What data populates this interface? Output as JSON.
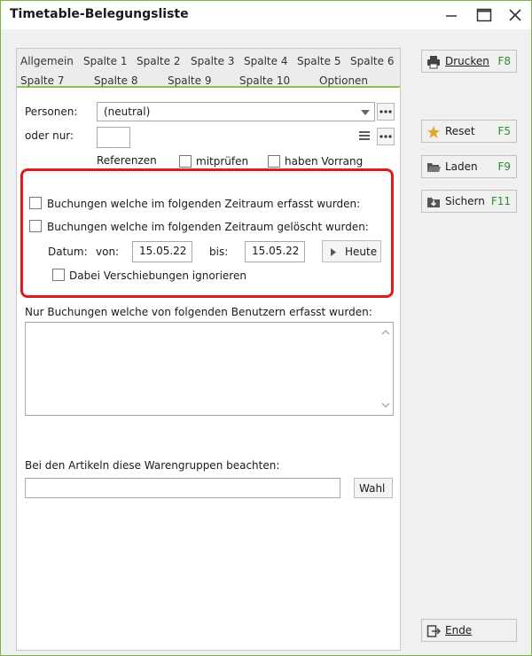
{
  "window": {
    "title": "Timetable-Belegungsliste"
  },
  "tabs": [
    {
      "label": "Allgemein"
    },
    {
      "label": "Spalte 1"
    },
    {
      "label": "Spalte 2"
    },
    {
      "label": "Spalte 3"
    },
    {
      "label": "Spalte 4"
    },
    {
      "label": "Spalte 5"
    },
    {
      "label": "Spalte 6"
    },
    {
      "label": "Spalte 7"
    },
    {
      "label": "Spalte 8"
    },
    {
      "label": "Spalte 9"
    },
    {
      "label": "Spalte 10"
    },
    {
      "label": "Optionen"
    }
  ],
  "active_tab": "Optionen",
  "persons": {
    "label": "Personen:",
    "value": "(neutral)",
    "or_only_label": "oder nur:",
    "or_only_value": ""
  },
  "references": {
    "label": "Referenzen",
    "check_label": "mitprüfen",
    "priority_label": "haben Vorrang"
  },
  "period": {
    "created_label": "Buchungen welche im folgenden Zeitraum erfasst wurden:",
    "deleted_label": "Buchungen welche im folgenden Zeitraum gelöscht wurden:",
    "date_label": "Datum:",
    "from_label": "von:",
    "from_value": "15.05.22",
    "to_label": "bis:",
    "to_value": "15.05.22",
    "today_button": "Heute",
    "ignore_shifts_label": "Dabei Verschiebungen ignorieren"
  },
  "users": {
    "label": "Nur Buchungen welche von folgenden Benutzern erfasst wurden:"
  },
  "article_groups": {
    "label": "Bei den Artikeln diese Warengruppen beachten:",
    "value": "",
    "choose_button": "Wahl"
  },
  "sidebar": {
    "print": {
      "label": "Drucken",
      "key": "F8"
    },
    "reset": {
      "label": "Reset",
      "key": "F5"
    },
    "load": {
      "label": "Laden",
      "key": "F9"
    },
    "save": {
      "label": "Sichern",
      "key": "F11"
    },
    "end": {
      "label": "Ende"
    }
  },
  "colors": {
    "accent": "#8bc34a",
    "highlight": "#e01b1b",
    "shortcut": "#2e8b2e"
  }
}
